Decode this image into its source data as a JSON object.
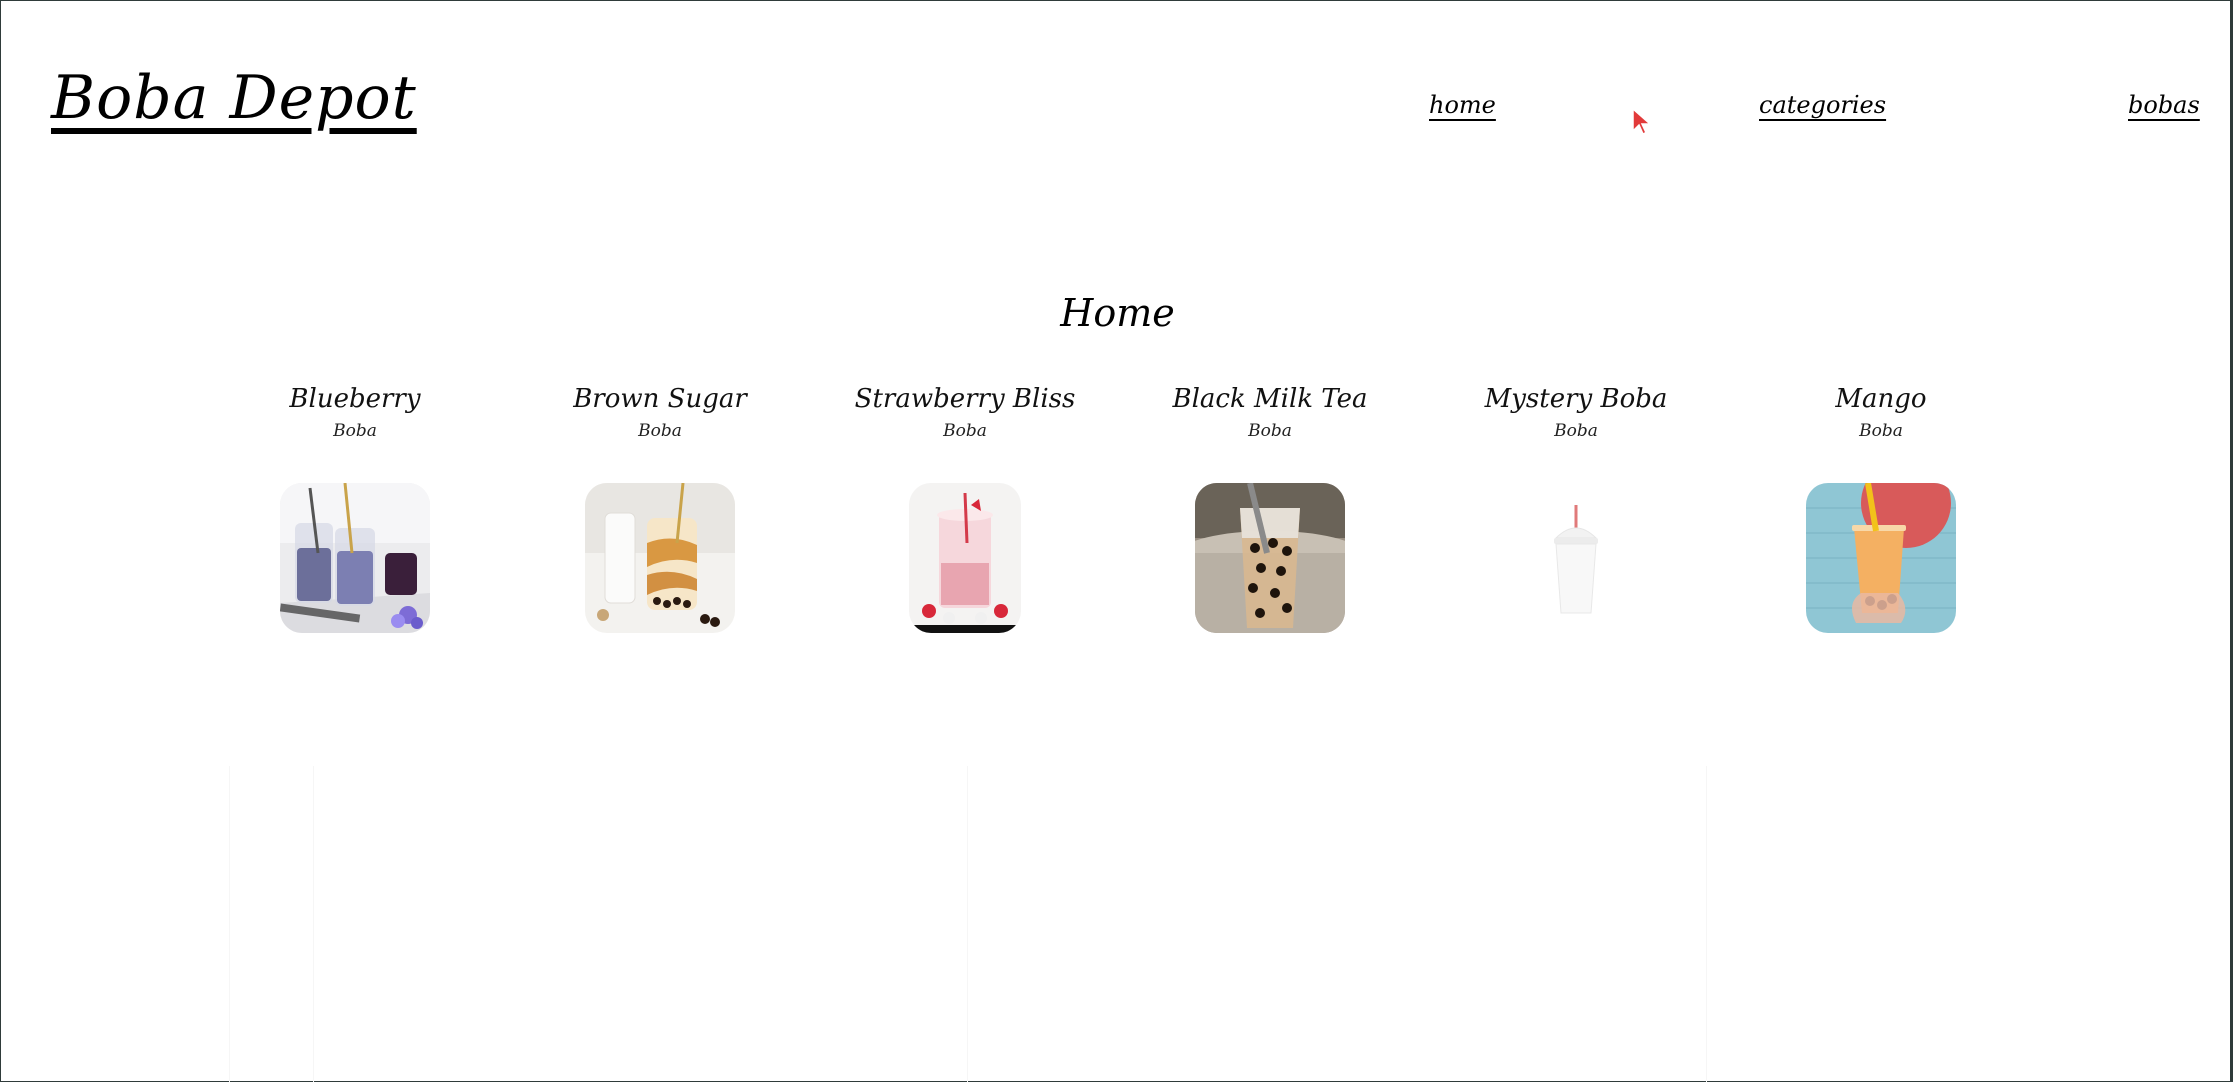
{
  "header": {
    "brand": "Boba Depot",
    "nav": [
      {
        "label": "home"
      },
      {
        "label": "categories"
      },
      {
        "label": "bobas"
      }
    ]
  },
  "main": {
    "title": "Home",
    "items": [
      {
        "name": "Blueberry",
        "category": "Boba",
        "image_icon": "blueberry-boba-image"
      },
      {
        "name": "Brown Sugar",
        "category": "Boba",
        "image_icon": "brown-sugar-boba-image"
      },
      {
        "name": "Strawberry Bliss",
        "category": "Boba",
        "image_icon": "strawberry-boba-image"
      },
      {
        "name": "Black Milk Tea",
        "category": "Boba",
        "image_icon": "milk-tea-boba-image"
      },
      {
        "name": "Mystery Boba",
        "category": "Boba",
        "image_icon": "empty-cup-image"
      },
      {
        "name": "Mango",
        "category": "Boba",
        "image_icon": "mango-boba-image"
      }
    ]
  }
}
